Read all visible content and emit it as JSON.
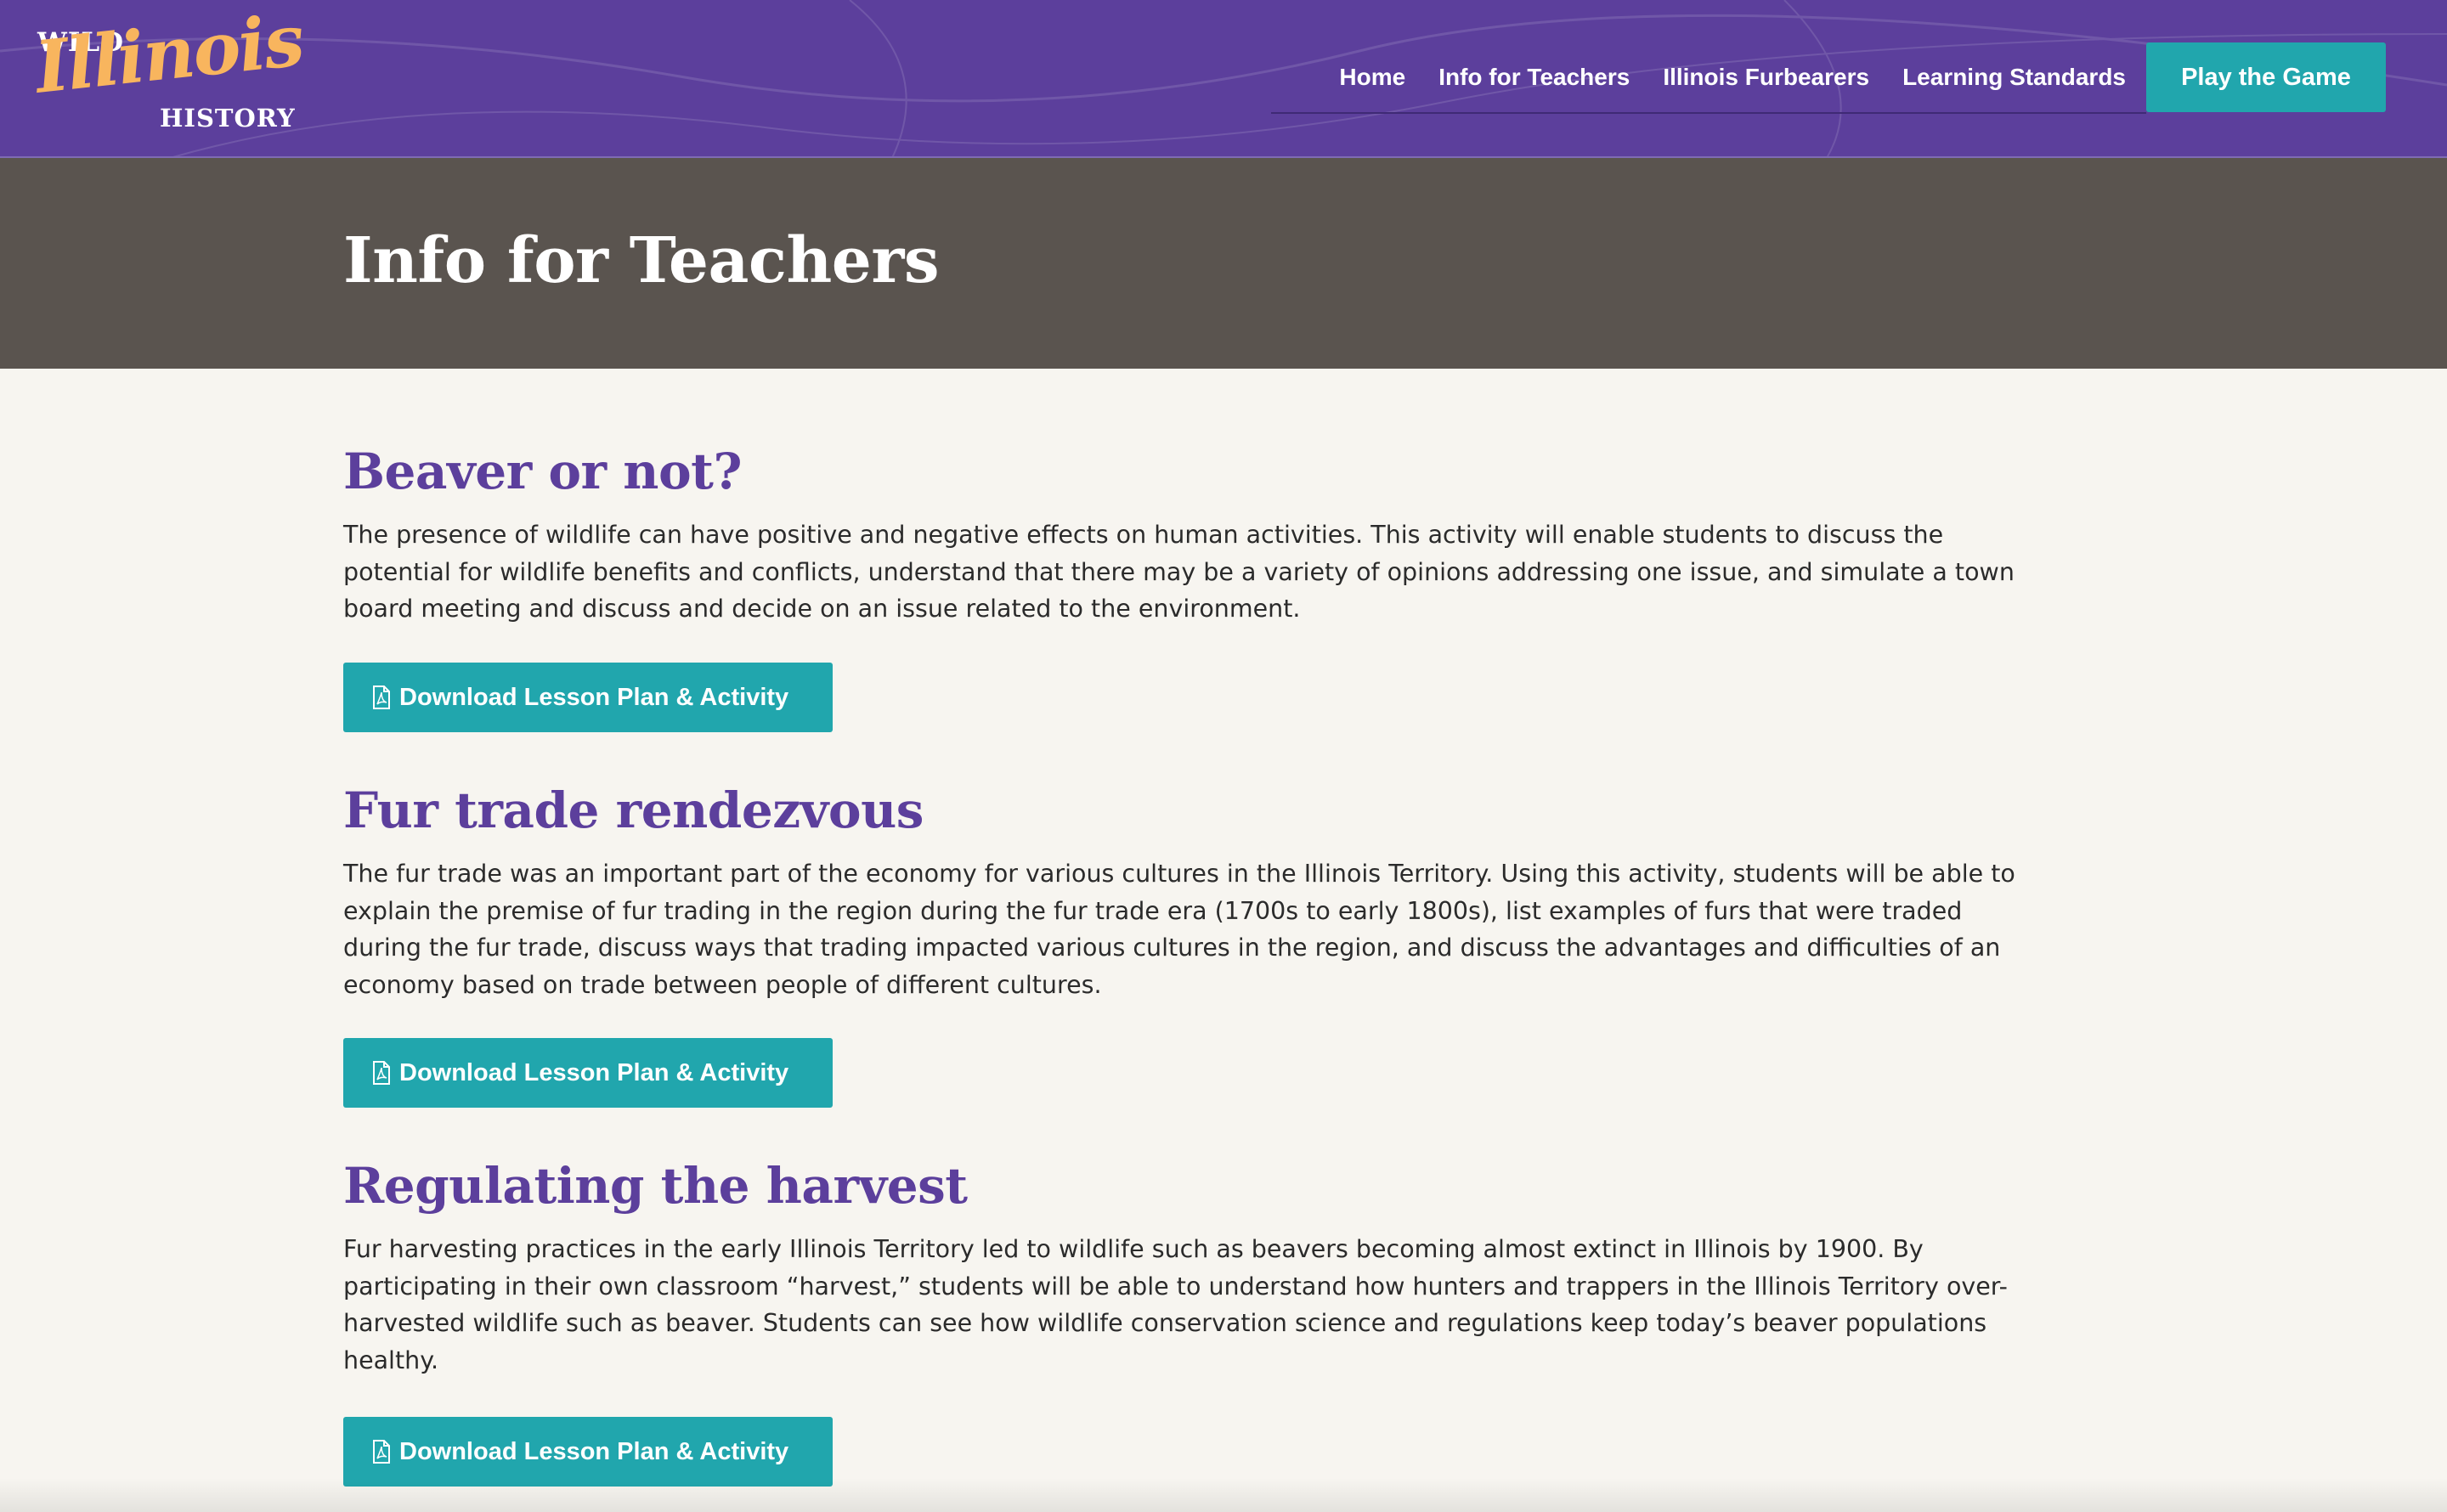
{
  "header": {
    "logo": {
      "top": "WILD",
      "main": "Illinois",
      "bottom": "HISTORY"
    },
    "nav": [
      {
        "label": "Home"
      },
      {
        "label": "Info for Teachers"
      },
      {
        "label": "Illinois Furbearers"
      },
      {
        "label": "Learning Standards"
      }
    ],
    "cta_label": "Play the Game"
  },
  "hero": {
    "title": "Info for Teachers"
  },
  "sections": [
    {
      "title": "Beaver or not?",
      "body": "The presence of wildlife can have positive and negative effects on human activities. This activity will enable students to discuss the potential for wildlife benefits and conflicts, understand that there may be a variety of opinions addressing one issue, and simulate a town board meeting and discuss and decide on an issue related to the environment.",
      "button": "Download Lesson Plan & Activity"
    },
    {
      "title": "Fur trade rendezvous",
      "body": "The fur trade was an important part of the economy for various cultures in the Illinois Territory. Using this activity, students will be able to explain the premise of fur trading in the region during the fur trade era (1700s to early 1800s), list examples of furs that were traded during the fur trade, discuss ways that trading impacted various cultures in the region, and discuss the advantages and difficulties of an economy based on trade between people of different cultures.",
      "button": "Download Lesson Plan & Activity"
    },
    {
      "title": "Regulating the harvest",
      "body": "Fur harvesting practices in the early Illinois Territory led to wildlife such as beavers becoming almost extinct in Illinois by 1900. By participating in their own classroom “harvest,” students will be able to understand how hunters and trappers in the Illinois Territory over-harvested wildlife such as beaver. Students can see how wildlife conservation science and regulations keep today’s beaver populations healthy.",
      "button": "Download Lesson Plan & Activity"
    }
  ],
  "colors": {
    "header_purple": "#5c3f9c",
    "accent_teal": "#21a6ad",
    "logo_orange": "#f8b55e",
    "hero_gray": "#5a544f",
    "page_bg": "#f7f5f0"
  },
  "icons": {
    "download_button_icon": "pdf-file-icon"
  }
}
